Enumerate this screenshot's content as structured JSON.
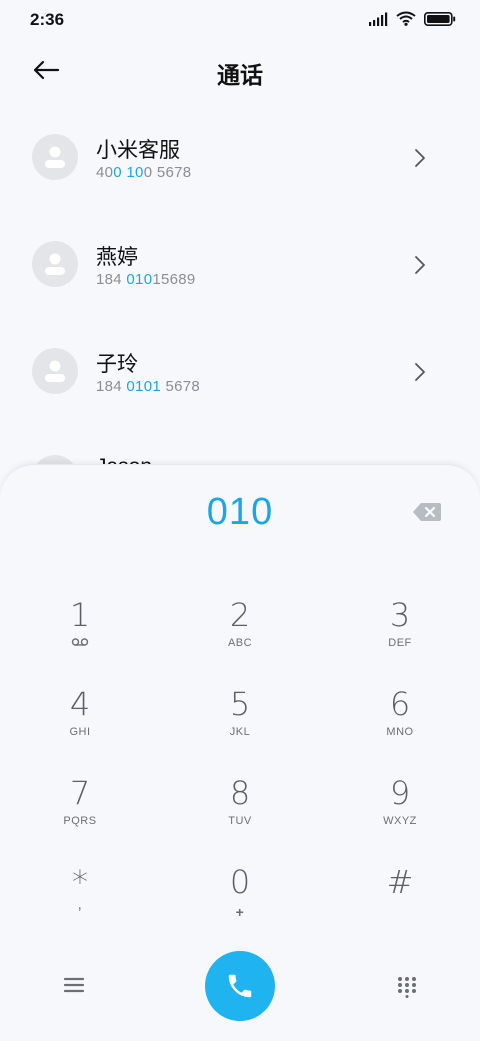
{
  "status_bar": {
    "time": "2:36"
  },
  "header": {
    "title": "通话"
  },
  "contacts": [
    {
      "name": "小米客服",
      "number_parts": [
        "40",
        "0 10",
        "0 5678"
      ]
    },
    {
      "name": "燕婷",
      "number_parts": [
        "184 ",
        "010",
        "15689"
      ]
    },
    {
      "name": "子玲",
      "number_parts": [
        "184 ",
        "0101",
        " 5678"
      ]
    },
    {
      "name": "Jason",
      "number_parts": [
        "",
        "",
        ""
      ]
    }
  ],
  "dialpad": {
    "input": "010",
    "keys": [
      {
        "digit": "1",
        "letters": ""
      },
      {
        "digit": "2",
        "letters": "ABC"
      },
      {
        "digit": "3",
        "letters": "DEF"
      },
      {
        "digit": "4",
        "letters": "GHI"
      },
      {
        "digit": "5",
        "letters": "JKL"
      },
      {
        "digit": "6",
        "letters": "MNO"
      },
      {
        "digit": "7",
        "letters": "PQRS"
      },
      {
        "digit": "8",
        "letters": "TUV"
      },
      {
        "digit": "9",
        "letters": "WXYZ"
      },
      {
        "digit": "*",
        "letters": ","
      },
      {
        "digit": "0",
        "letters": "+"
      },
      {
        "digit": "#",
        "letters": ""
      }
    ]
  },
  "icons": {
    "signal": "signal-icon",
    "wifi": "wifi-icon",
    "battery": "battery-icon",
    "back": "back-arrow-icon",
    "chevron": "chevron-right-icon",
    "backspace": "backspace-icon",
    "voicemail": "voicemail-icon",
    "menu": "menu-icon",
    "call": "phone-icon",
    "grid": "dialpad-grid-icon"
  },
  "colors": {
    "accent": "#1aa6e6",
    "call_button": "#1fb4f0"
  }
}
